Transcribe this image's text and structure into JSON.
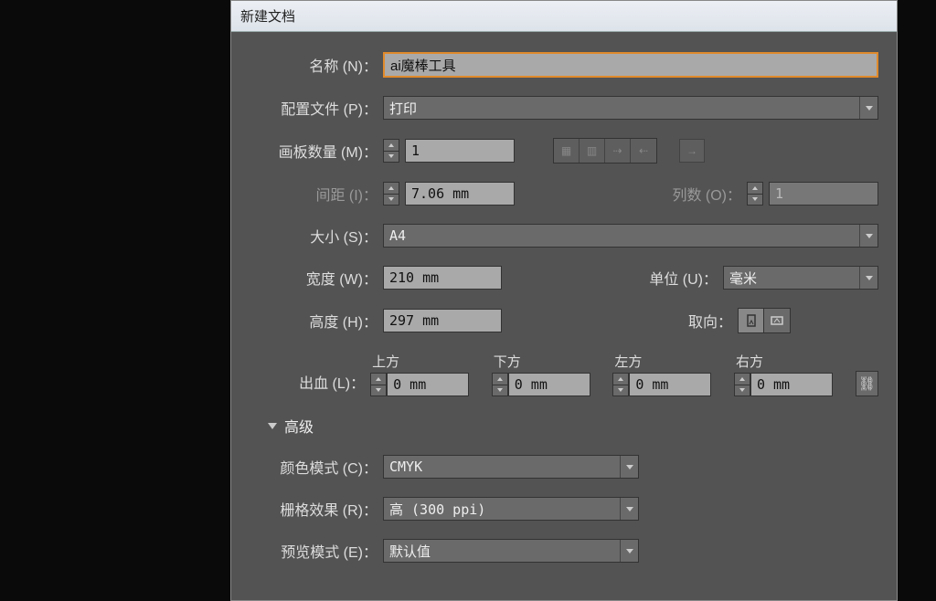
{
  "title": "新建文档",
  "name": {
    "label": "名称 (N)：",
    "value": "ai魔棒工具"
  },
  "profile": {
    "label": "配置文件 (P)：",
    "value": "打印"
  },
  "artboards": {
    "label": "画板数量 (M)：",
    "value": "1"
  },
  "spacing": {
    "label": "间距 (I)：",
    "value": "7.06 mm"
  },
  "columns": {
    "label": "列数 (O)：",
    "value": "1"
  },
  "size": {
    "label": "大小 (S)：",
    "value": "A4"
  },
  "width": {
    "label": "宽度 (W)：",
    "value": "210 mm"
  },
  "units": {
    "label": "单位 (U)：",
    "value": "毫米"
  },
  "height": {
    "label": "高度 (H)：",
    "value": "297 mm"
  },
  "orientation": {
    "label": "取向："
  },
  "bleed": {
    "label": "出血 (L)：",
    "top": {
      "label": "上方",
      "value": "0 mm"
    },
    "bottom": {
      "label": "下方",
      "value": "0 mm"
    },
    "left": {
      "label": "左方",
      "value": "0 mm"
    },
    "right": {
      "label": "右方",
      "value": "0 mm"
    }
  },
  "advanced": "高级",
  "colorMode": {
    "label": "颜色模式 (C)：",
    "value": "CMYK"
  },
  "raster": {
    "label": "栅格效果 (R)：",
    "value": "高 (300 ppi)"
  },
  "preview": {
    "label": "预览模式 (E)：",
    "value": "默认值"
  }
}
